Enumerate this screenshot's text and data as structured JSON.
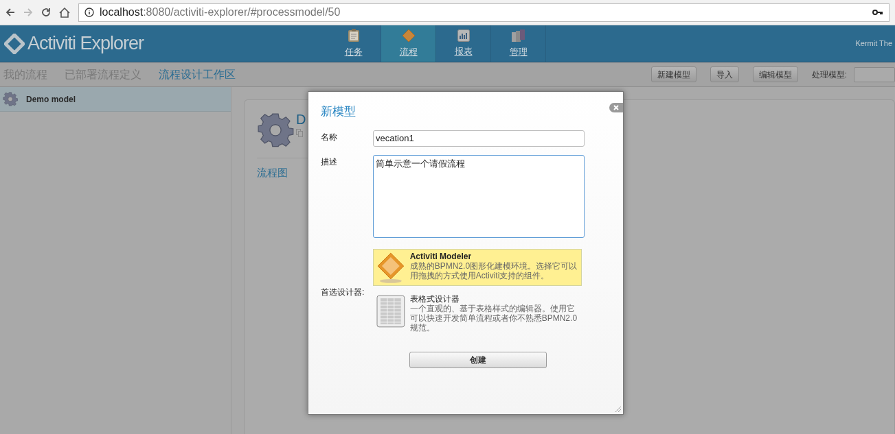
{
  "browser": {
    "url_host": "localhost",
    "url_rest": ":8080/activiti-explorer/#processmodel/50"
  },
  "header": {
    "logo": "Activiti Explorer",
    "user": "Kermit The",
    "nav": [
      {
        "label": "任务",
        "kind": "clipboard",
        "selected": false
      },
      {
        "label": "流程",
        "kind": "diamond",
        "selected": true
      },
      {
        "label": "报表",
        "kind": "chart",
        "selected": false
      },
      {
        "label": "管理",
        "kind": "admin",
        "selected": false
      }
    ]
  },
  "subnav": {
    "links": [
      {
        "label": "我的流程",
        "selected": false
      },
      {
        "label": "已部署流程定义",
        "selected": false
      },
      {
        "label": "流程设计工作区",
        "selected": true
      }
    ],
    "buttons": [
      "新建模型",
      "导入",
      "编辑模型"
    ],
    "process_label": "处理模型:"
  },
  "sidebar": {
    "items": [
      {
        "label": "Demo model",
        "selected": true
      }
    ]
  },
  "main": {
    "title": "D",
    "tab": "流程图"
  },
  "dialog": {
    "title": "新模型",
    "name_label": "名称",
    "name_value": "vecation1",
    "desc_label": "描述",
    "desc_value": "简单示意一个请假流程",
    "designer_label": "首选设计器:",
    "designers": [
      {
        "kind": "modeler",
        "title": "Activiti Modeler",
        "description": "成熟的BPMN2.0图形化建模环境。选择它可以用拖拽的方式使用Activiti支持的组件。",
        "selected": true
      },
      {
        "kind": "table",
        "title": "表格式设计器",
        "description": "一个直观的、基于表格样式的编辑器。使用它可以快速开发简单流程或者你不熟悉BPMN2.0规范。",
        "selected": false
      }
    ],
    "create_button": "创建"
  }
}
